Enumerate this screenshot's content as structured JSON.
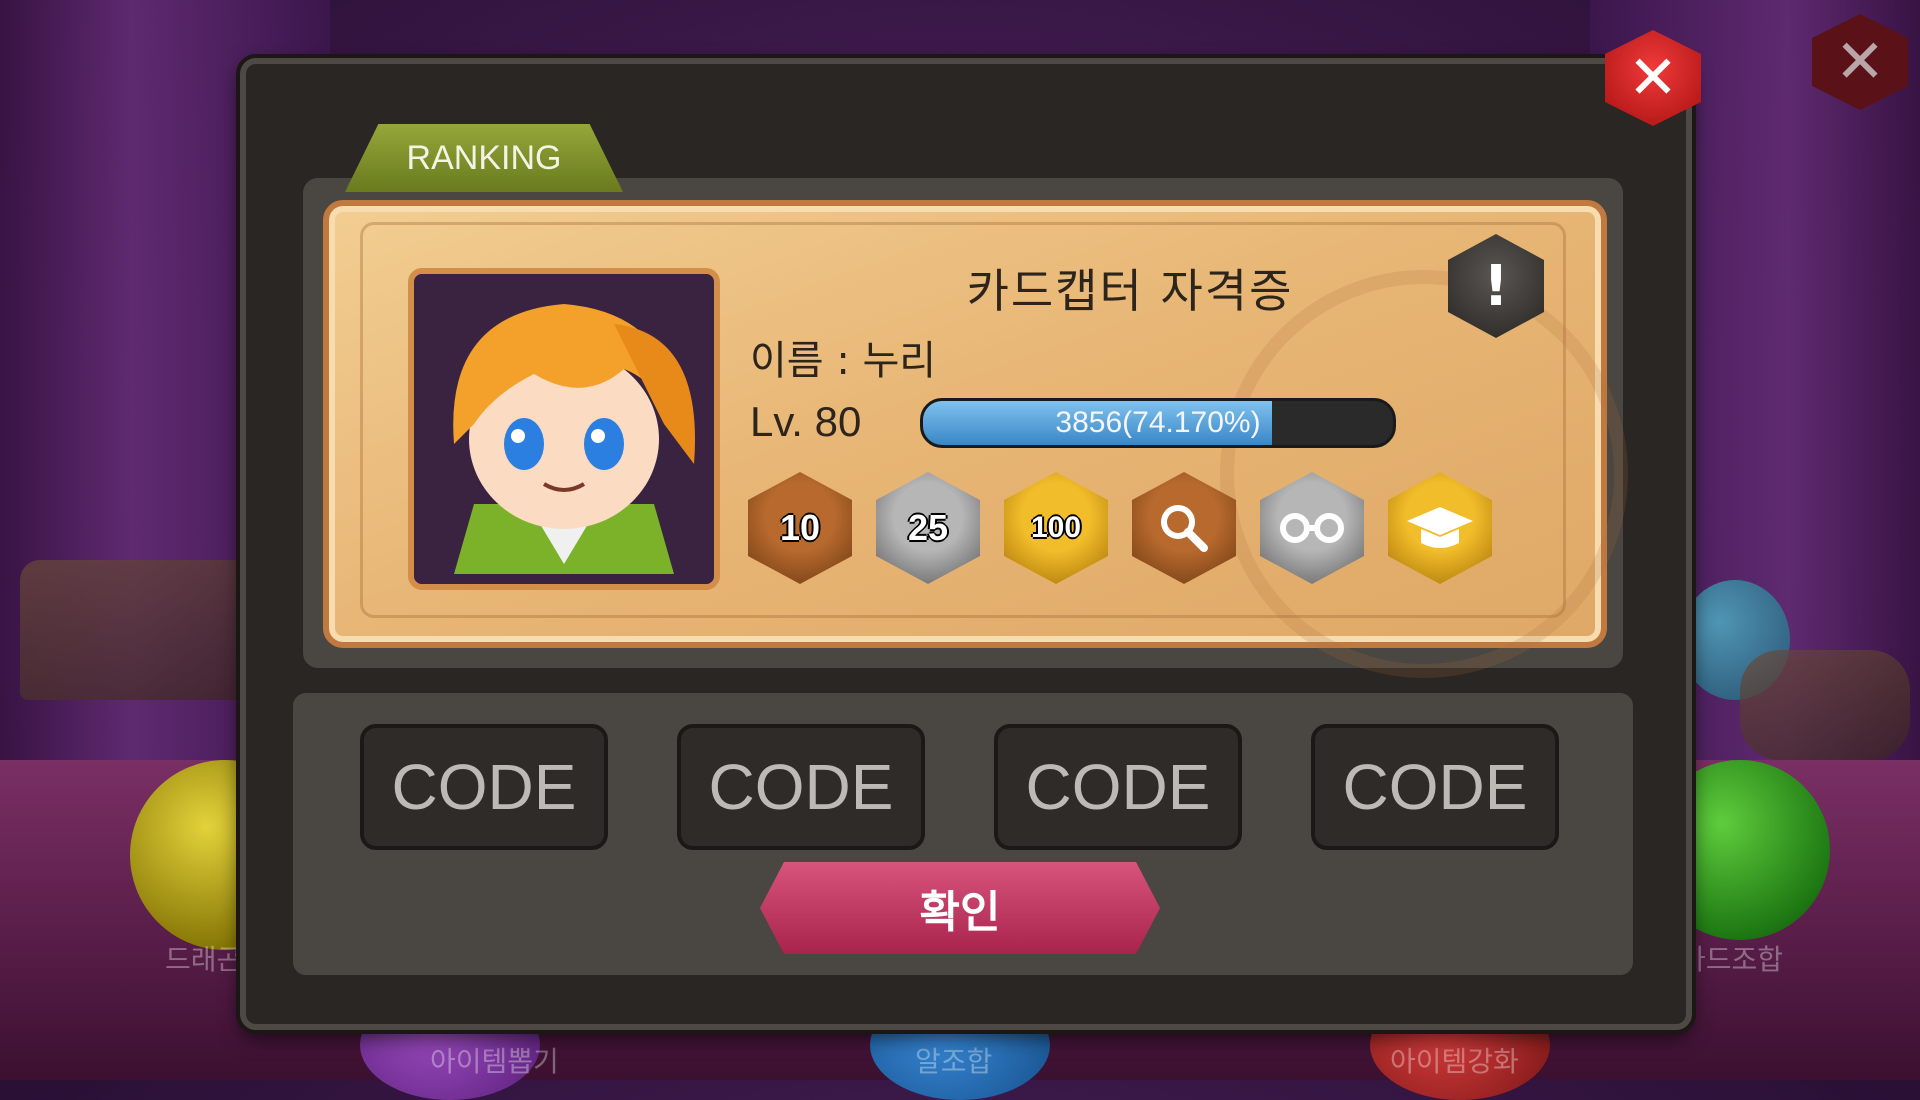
{
  "background": {
    "labels": {
      "left_orb": "드래곤",
      "right_orb": "카드조합",
      "bottom_1": "아이템뽑기",
      "bottom_2": "알조합",
      "bottom_3": "아이템강화"
    }
  },
  "dialog": {
    "tab_label": "RANKING",
    "card": {
      "title": "카드캡터 자격증",
      "name_line": "이름 : 누리",
      "level": "Lv. 80",
      "xp_text": "3856(74.170%)",
      "xp_fraction": 0.7417,
      "badges": [
        {
          "label": "10",
          "tier": "bronze"
        },
        {
          "label": "25",
          "tier": "silver"
        },
        {
          "label": "100",
          "tier": "gold"
        },
        {
          "label": "",
          "tier": "bronze",
          "icon": "magnifier-icon"
        },
        {
          "label": "",
          "tier": "silver",
          "icon": "glasses-icon"
        },
        {
          "label": "",
          "tier": "gold",
          "icon": "graduation-cap-icon"
        }
      ]
    },
    "codes": [
      "CODE",
      "CODE",
      "CODE",
      "CODE"
    ],
    "confirm_label": "확인"
  },
  "colors": {
    "close_red": "#e02424",
    "tab_green": "#8a9c32",
    "card_beige": "#edc486",
    "confirm_pink": "#c03a62",
    "xp_blue": "#4a9ad6"
  }
}
